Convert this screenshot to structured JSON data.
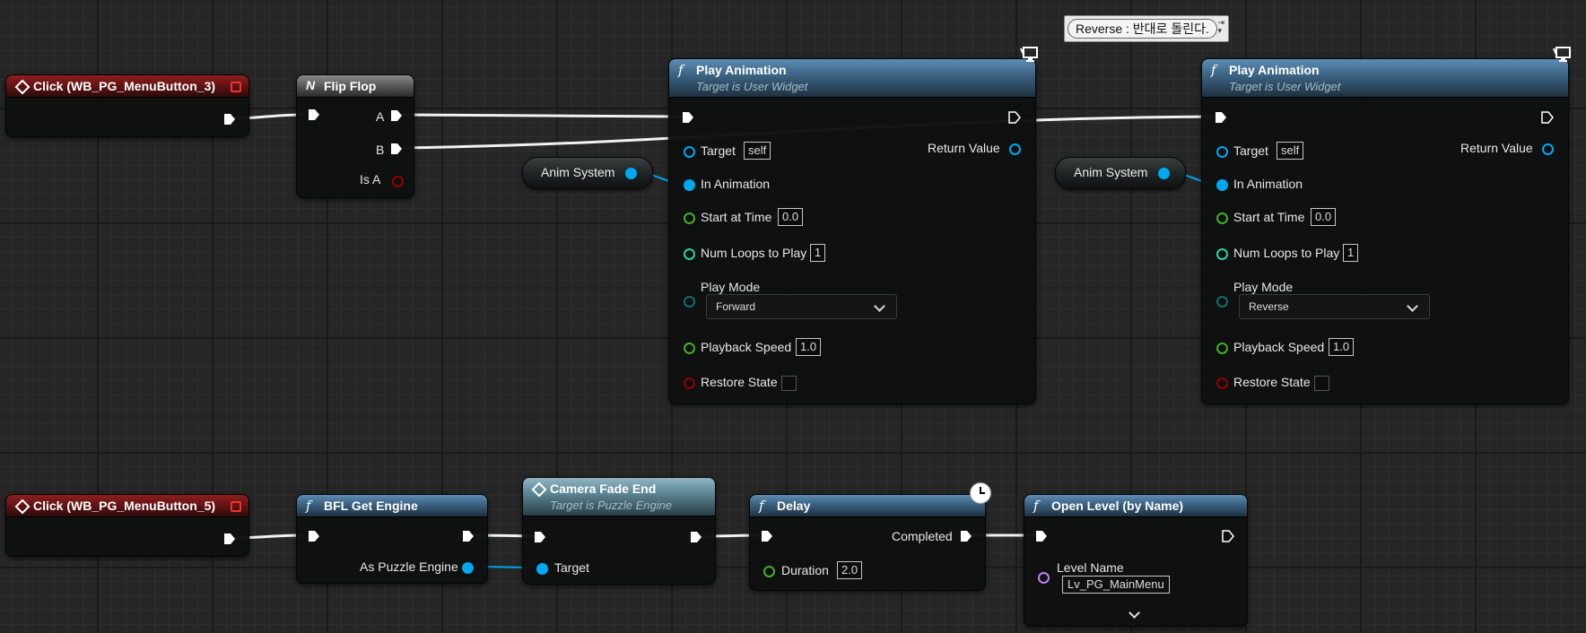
{
  "colors": {
    "exec": "#ffffff",
    "object_pin": "#00a8f2",
    "float_pin": "#3fb02a",
    "int_pin": "#2fcfa6",
    "byte_pin": "#0e6f6f",
    "bool_pin": "#950000",
    "name_pin": "#c77df2",
    "event_header": "#8c1e1e",
    "function_header": "#3d6586"
  },
  "events": [
    {
      "title": "Click (WB_PG_MenuButton_3)"
    },
    {
      "title": "Click (WB_PG_MenuButton_5)"
    }
  ],
  "flipflop": {
    "title": "Flip Flop",
    "pin_a": "A",
    "pin_b": "B",
    "pin_is_a": "Is A"
  },
  "play_animation_1": {
    "title": "Play Animation",
    "subtitle": "Target is User Widget",
    "target_label": "Target",
    "target_value": "self",
    "return_label": "Return Value",
    "in_animation": "In Animation",
    "start_at_time_label": "Start at Time",
    "start_at_time_value": "0.0",
    "num_loops_label": "Num Loops to Play",
    "num_loops_value": "1",
    "play_mode_label": "Play Mode",
    "play_mode_value": "Forward",
    "playback_speed_label": "Playback Speed",
    "playback_speed_value": "1.0",
    "restore_state_label": "Restore State"
  },
  "play_animation_2": {
    "title": "Play Animation",
    "subtitle": "Target is User Widget",
    "target_label": "Target",
    "target_value": "self",
    "return_label": "Return Value",
    "in_animation": "In Animation",
    "start_at_time_label": "Start at Time",
    "start_at_time_value": "0.0",
    "num_loops_label": "Num Loops to Play",
    "num_loops_value": "1",
    "play_mode_label": "Play Mode",
    "play_mode_value": "Reverse",
    "playback_speed_label": "Playback Speed",
    "playback_speed_value": "1.0",
    "restore_state_label": "Restore State"
  },
  "anim_vars": [
    {
      "label": "Anim System"
    },
    {
      "label": "Anim System"
    }
  ],
  "comment": {
    "text": "Reverse : 반대로 돌린다."
  },
  "bfl_get_engine": {
    "title": "BFL Get Engine",
    "output": "As Puzzle Engine"
  },
  "camera_fade_end": {
    "title": "Camera Fade End",
    "subtitle": "Target is Puzzle Engine",
    "target_label": "Target"
  },
  "delay": {
    "title": "Delay",
    "completed": "Completed",
    "duration_label": "Duration",
    "duration_value": "2.0"
  },
  "open_level": {
    "title": "Open Level (by Name)",
    "level_name_label": "Level Name",
    "level_name_value": "Lv_PG_MainMenu"
  }
}
